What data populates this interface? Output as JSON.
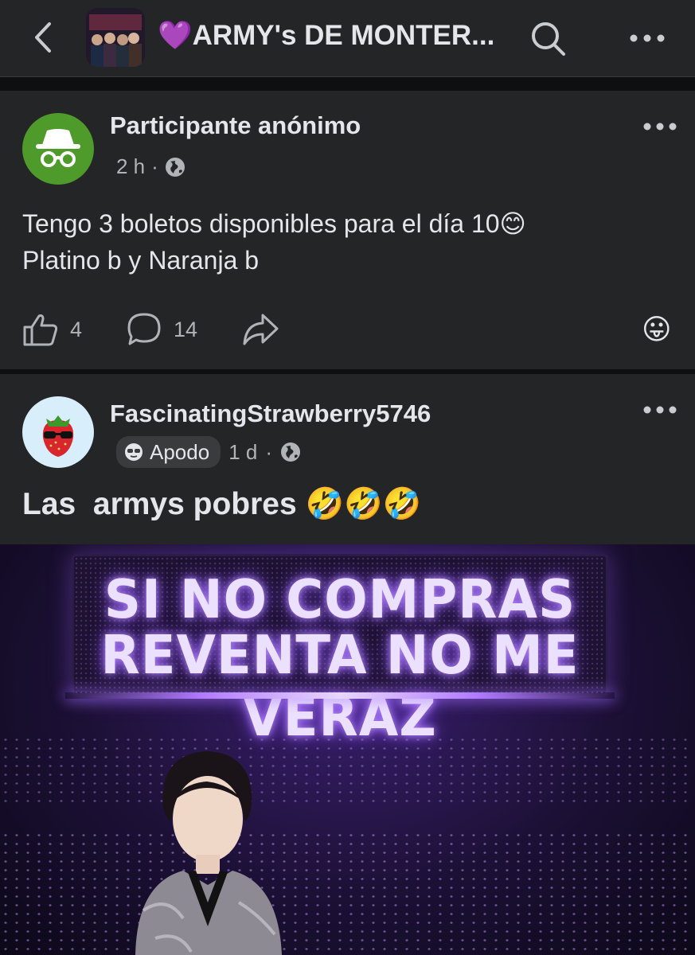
{
  "header": {
    "back_icon": "chevron-left-icon",
    "heart": "💜",
    "title": "ARMY's DE MONTER...",
    "search_icon": "search-icon",
    "more_icon": "more-horizontal-icon"
  },
  "posts": [
    {
      "author": "Participante anónimo",
      "avatar_icon": "anonymous-incognito-icon",
      "time": "2 h",
      "separator": "·",
      "privacy_icon": "globe-icon",
      "text_line1": "Tengo 3 boletos disponibles para el día 10😊",
      "text_line2": "Platino b y Naranja b",
      "likes": "4",
      "comments": "14",
      "reaction_emoji": "😛"
    },
    {
      "author": "FascinatingStrawberry5746",
      "avatar_icon": "strawberry-sunglasses-avatar",
      "badge": "Apodo",
      "time": "1 d",
      "separator": "·",
      "privacy_icon": "globe-icon",
      "text": "Las  armys pobres 🤣🤣🤣",
      "meme_line1": "SI NO COMPRAS",
      "meme_line2": "REVENTA NO ME VERAZ"
    }
  ],
  "colors": {
    "background": "#18191a",
    "surface": "#242526",
    "text": "#e4e6eb",
    "muted": "#b0b3b8",
    "anon_green": "#4e9a2a",
    "accent_purple": "#a259e6"
  }
}
